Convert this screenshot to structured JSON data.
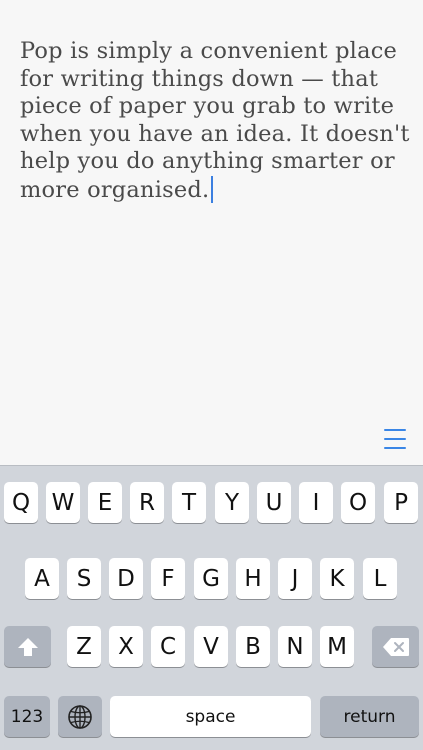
{
  "editor": {
    "text": "Pop is simply a convenient place for writing things down — that piece of paper you grab to write when you have an idea. It doesn't help you do anything smarter or more organised."
  },
  "menu": {
    "icon": "hamburger-menu-icon",
    "accent_color": "#3a86e6"
  },
  "keyboard": {
    "row1": [
      "Q",
      "W",
      "E",
      "R",
      "T",
      "Y",
      "U",
      "I",
      "O",
      "P"
    ],
    "row2": [
      "A",
      "S",
      "D",
      "F",
      "G",
      "H",
      "J",
      "K",
      "L"
    ],
    "row3": [
      "Z",
      "X",
      "C",
      "V",
      "B",
      "N",
      "M"
    ],
    "shift_icon": "shift-arrow-icon",
    "backspace_icon": "backspace-icon",
    "numbers_label": "123",
    "globe_icon": "globe-icon",
    "space_label": "space",
    "return_label": "return"
  }
}
